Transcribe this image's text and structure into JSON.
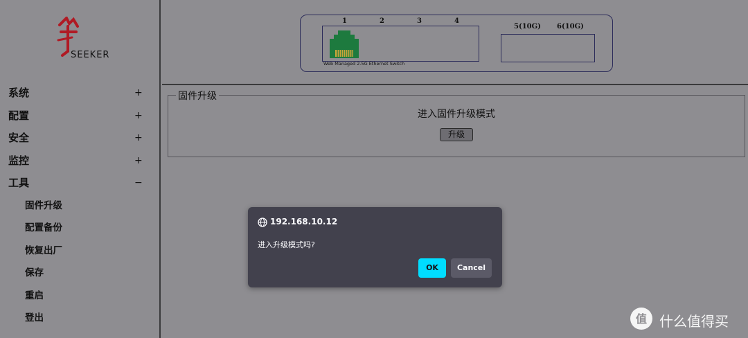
{
  "logo": {
    "text": "SEEKER"
  },
  "sidebar": {
    "items": [
      {
        "label": "系统",
        "toggle": "+"
      },
      {
        "label": "配置",
        "toggle": "+"
      },
      {
        "label": "安全",
        "toggle": "+"
      },
      {
        "label": "监控",
        "toggle": "+"
      },
      {
        "label": "工具",
        "toggle": "−"
      }
    ],
    "tools_sub": [
      {
        "label": "固件升级"
      },
      {
        "label": "配置备份"
      },
      {
        "label": "恢复出厂"
      },
      {
        "label": "保存"
      },
      {
        "label": "重启"
      },
      {
        "label": "登出"
      }
    ]
  },
  "switch_panel": {
    "ports": [
      "1",
      "2",
      "3",
      "4"
    ],
    "sfp_ports": [
      "5(10G)",
      "6(10G)"
    ],
    "caption": "Web Managed 2.5G Ethernet Switch",
    "port_color": "#1d7a3e"
  },
  "firmware": {
    "legend": "固件升级",
    "text": "进入固件升级模式",
    "button": "升级"
  },
  "dialog": {
    "title": "192.168.10.12",
    "message": "进入升级模式吗?",
    "ok": "OK",
    "cancel": "Cancel",
    "accent": "#00ddff"
  },
  "watermark": {
    "text": "什么值得买"
  }
}
